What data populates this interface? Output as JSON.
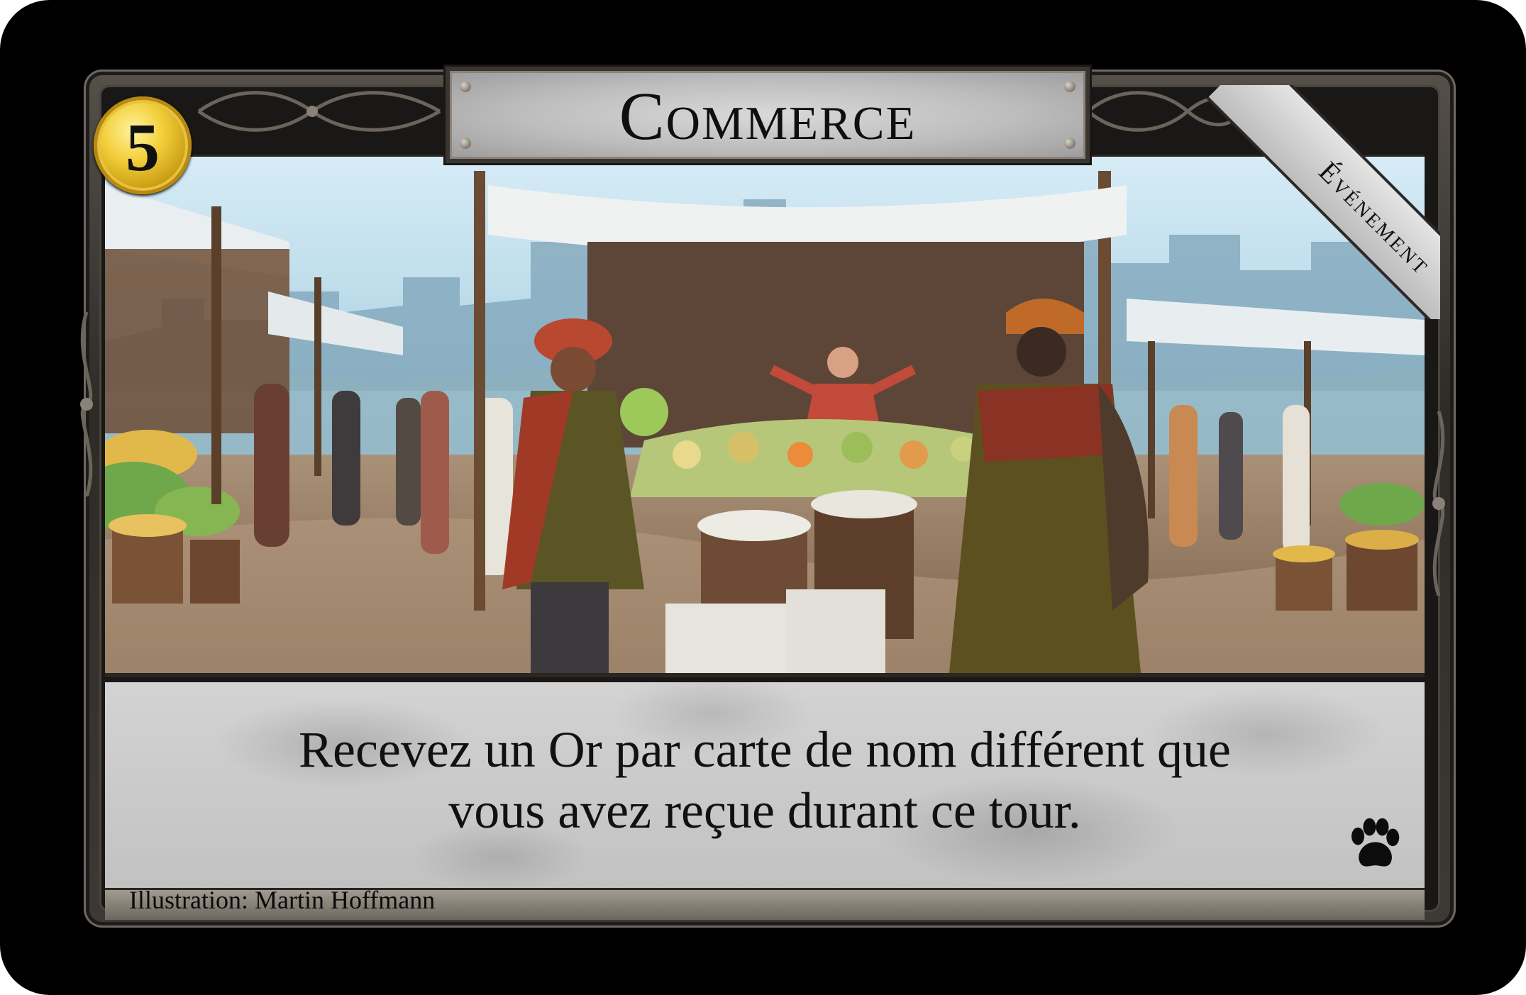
{
  "card": {
    "title": "Commerce",
    "cost": "5",
    "type": "Événement",
    "effect_line1": "Recevez un Or par carte de nom différent que",
    "effect_line2": "vous avez reçue durant ce tour.",
    "illustrator": "Illustration: Martin Hoffmann",
    "set_icon": "paw-print-icon",
    "colors": {
      "coin_gold": "#f2cf3a",
      "title_plate": "#bdbdbd",
      "text_box": "#c9c9c9",
      "frame": "#3d3934"
    }
  }
}
